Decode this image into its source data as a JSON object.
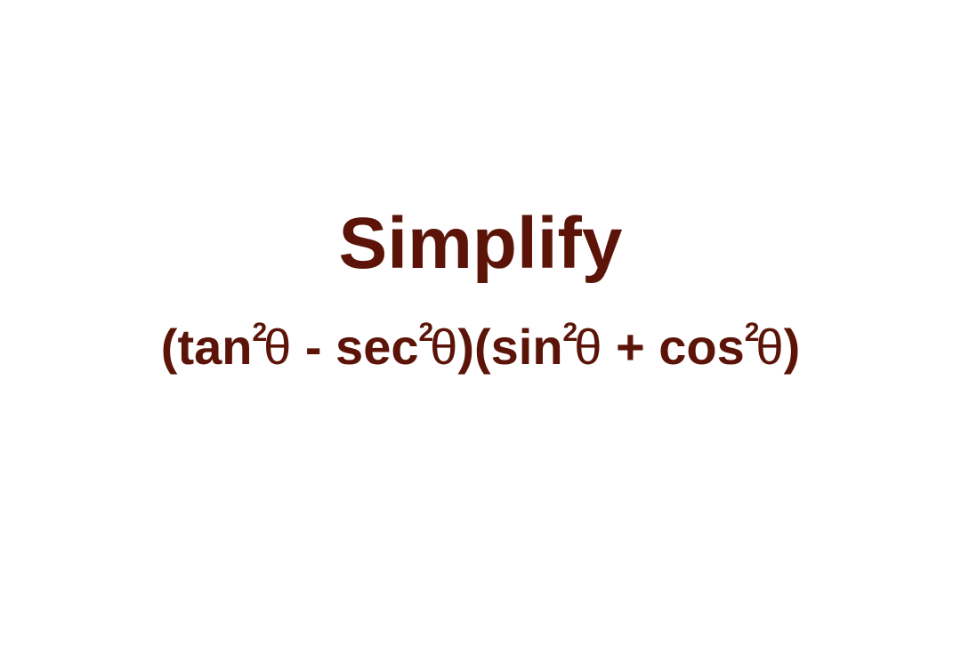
{
  "title": "Simplify",
  "expression": {
    "open1": "(",
    "t1_fn": "tan",
    "t1_exp": "2",
    "t1_var": "θ",
    "op1": " - ",
    "t2_fn": "sec",
    "t2_exp": "2",
    "t2_var": "θ",
    "close1_open2": ")(",
    "t3_fn": "sin",
    "t3_exp": "2",
    "t3_var": "θ",
    "op2": " + ",
    "t4_fn": "cos",
    "t4_exp": "2",
    "t4_var": "θ",
    "close2": ")"
  },
  "colors": {
    "text": "#5c1408",
    "background": "#ffffff"
  }
}
